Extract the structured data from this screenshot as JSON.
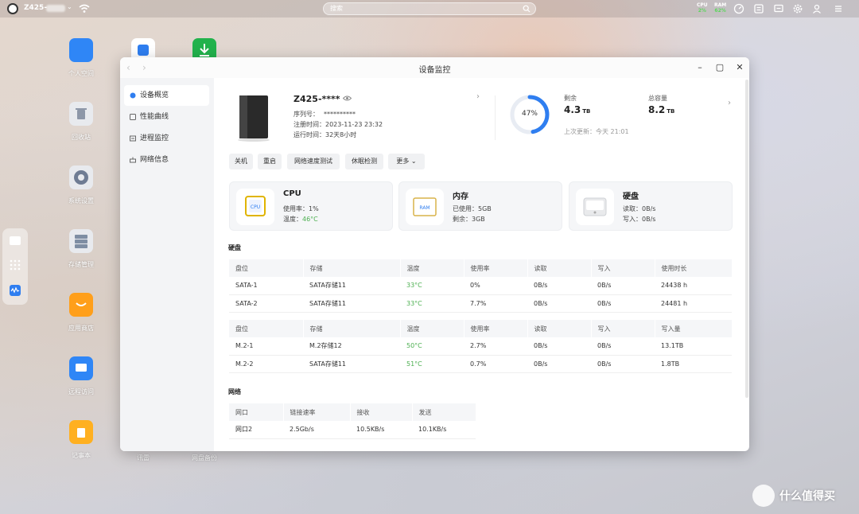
{
  "topbar": {
    "device_name": "Z425-",
    "search_placeholder": "搜索",
    "cpu": {
      "label": "CPU",
      "value": "2%"
    },
    "ram": {
      "label": "RAM",
      "value": "62%"
    }
  },
  "desktop_icons": [
    {
      "name": "personal-space",
      "label": "个人空间",
      "color": "#2f86f6"
    },
    {
      "name": "recycle-bin",
      "label": "回收站",
      "color": "#8d97a8"
    },
    {
      "name": "system-settings",
      "label": "系统设置",
      "color": "#6f7c93"
    },
    {
      "name": "storage-manager",
      "label": "存储管理",
      "color": "#7f8ea3"
    },
    {
      "name": "app-store",
      "label": "应用商店",
      "color": "#ff9f1a"
    },
    {
      "name": "remote-access",
      "label": "远程访问",
      "color": "#2f86f6"
    },
    {
      "name": "notepad",
      "label": "记事本",
      "color": "#ffb020"
    },
    {
      "name": "app-2",
      "label": "",
      "color": "#2f7ef0"
    },
    {
      "name": "download",
      "label": "",
      "color": "#22b24c"
    },
    {
      "name": "bottom-label-1",
      "label": "讯雷"
    },
    {
      "name": "bottom-label-2",
      "label": "网盘备份"
    }
  ],
  "window": {
    "title": "设备监控",
    "sidebar": [
      {
        "label": "设备概览",
        "icon": "overview-icon",
        "active": true
      },
      {
        "label": "性能曲线",
        "icon": "chart-icon",
        "active": false
      },
      {
        "label": "进程监控",
        "icon": "process-icon",
        "active": false
      },
      {
        "label": "网络信息",
        "icon": "network-icon",
        "active": false
      }
    ],
    "device": {
      "name": "Z425-****",
      "serial_label": "序列号：",
      "serial_value": "**********",
      "reg_label": "注册时间：",
      "reg_value": "2023-11-23 23:32",
      "uptime_label": "运行时间：",
      "uptime_value": "32天8小时"
    },
    "capacity": {
      "percent_label": "47%",
      "percent": 0.47,
      "remaining_label": "剩余",
      "remaining_value": "4.3",
      "remaining_unit": "TB",
      "total_label": "总容量",
      "total_value": "8.2",
      "total_unit": "TB",
      "updated": "上次更新：今天 21:01"
    },
    "buttons": [
      "关机",
      "重启",
      "网络速度测试",
      "休眠检测",
      "更多"
    ],
    "cards": {
      "cpu": {
        "title": "CPU",
        "icon_text": "CPU",
        "usage_label": "使用率：",
        "usage": "1%",
        "temp_label": "温度：",
        "temp": "46°C"
      },
      "mem": {
        "title": "内存",
        "icon_text": "RAM",
        "used_label": "已使用：",
        "used": "5GB",
        "free_label": "剩余：",
        "free": "3GB"
      },
      "disk": {
        "title": "硬盘",
        "read_label": "读取：",
        "read": "0B/s",
        "write_label": "写入：",
        "write": "0B/s"
      }
    },
    "disk_section_title": "硬盘",
    "sata_table": {
      "headers": [
        "盘位",
        "存储",
        "温度",
        "使用率",
        "读取",
        "写入",
        "使用时长"
      ],
      "rows": [
        [
          "SATA-1",
          "SATA存储11",
          "33°C",
          "0%",
          "0B/s",
          "0B/s",
          "24438 h"
        ],
        [
          "SATA-2",
          "SATA存储11",
          "33°C",
          "7.7%",
          "0B/s",
          "0B/s",
          "24481 h"
        ]
      ]
    },
    "m2_table": {
      "headers": [
        "盘位",
        "存储",
        "温度",
        "使用率",
        "读取",
        "写入",
        "写入量"
      ],
      "rows": [
        [
          "M.2-1",
          "M.2存储12",
          "50°C",
          "2.7%",
          "0B/s",
          "0B/s",
          "13.1TB"
        ],
        [
          "M.2-2",
          "SATA存储11",
          "51°C",
          "0.7%",
          "0B/s",
          "0B/s",
          "1.8TB"
        ]
      ]
    },
    "network_section_title": "网络",
    "net_table": {
      "headers": [
        "网口",
        "链接速率",
        "接收",
        "发送"
      ],
      "rows": [
        [
          "网口2",
          "2.5Gb/s",
          "10.5KB/s",
          "10.1KB/s"
        ]
      ]
    }
  },
  "watermark": {
    "text": "什么值得买"
  }
}
